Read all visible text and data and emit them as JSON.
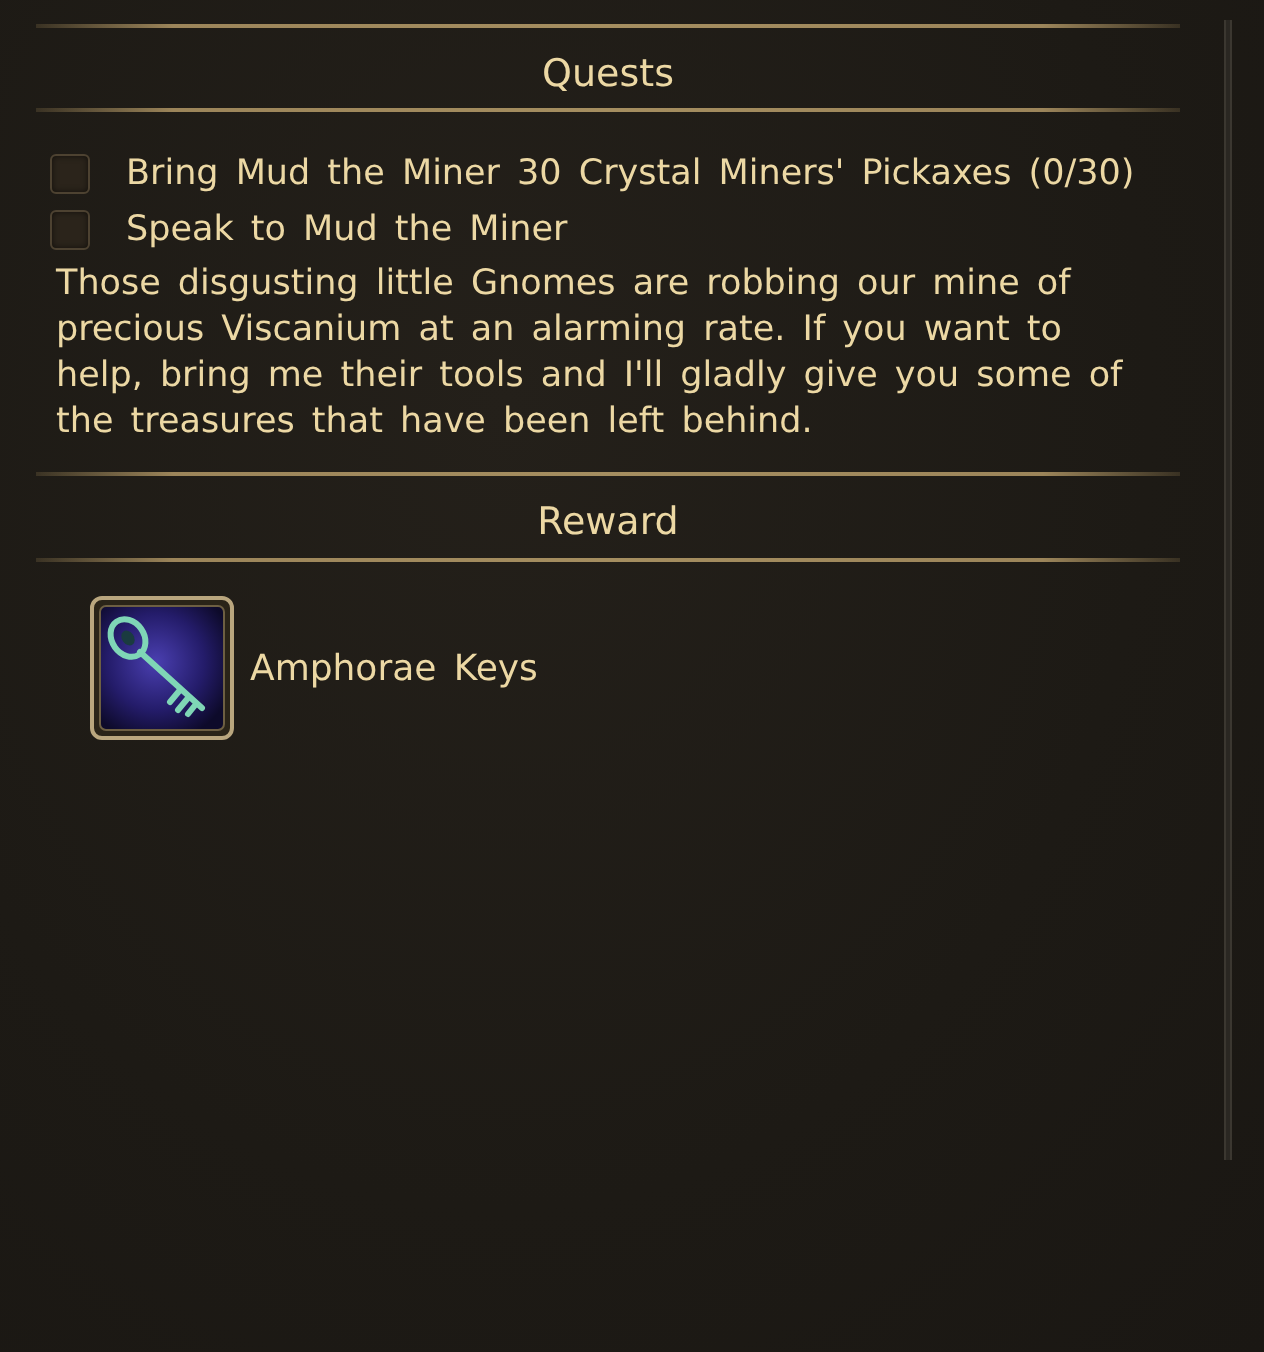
{
  "quests": {
    "heading": "Quests",
    "objectives": [
      {
        "text": "Bring Mud the Miner 30 Crystal Miners' Pickaxes (0/30)",
        "checked": false
      },
      {
        "text": "Speak to Mud the Miner",
        "checked": false
      }
    ],
    "description": "Those disgusting little Gnomes are robbing our mine of precious Viscanium at an alarming rate. If you want to help, bring me their tools and I'll gladly give you some of the treasures that have been left behind."
  },
  "reward": {
    "heading": "Reward",
    "items": [
      {
        "name": "Amphorae Keys"
      }
    ]
  }
}
